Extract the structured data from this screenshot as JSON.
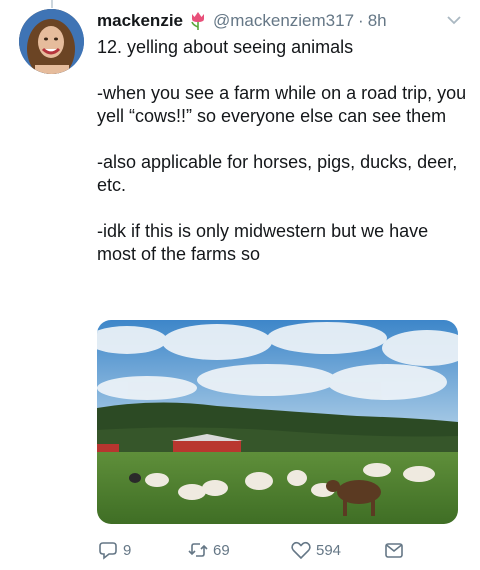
{
  "tweet": {
    "display_name": "mackenzie",
    "handle": "@mackenziem317",
    "separator": "·",
    "time": "8h",
    "paragraphs": [
      "12. yelling about seeing animals",
      "-when you see a farm while on a road trip, you yell “cows!!” so everyone else can see them",
      "-also applicable for horses, pigs, ducks, deer, etc.",
      "-idk if this is only midwestern but we have most of the farms so"
    ],
    "name_emoji": "tulip-icon",
    "image": "farm-animals-photo"
  },
  "actions": {
    "reply_count": "9",
    "retweet_count": "69",
    "like_count": "594"
  },
  "colors": {
    "text": "#14171a",
    "secondary": "#657786",
    "accent": "#1da1f2"
  }
}
